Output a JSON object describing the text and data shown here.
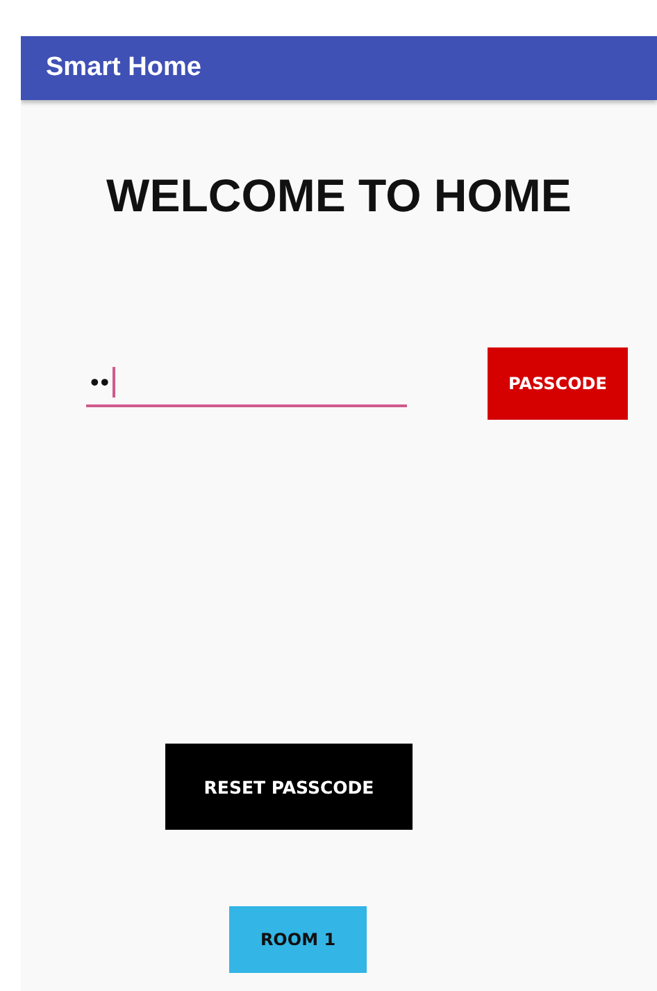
{
  "app_bar": {
    "title": "Smart Home"
  },
  "heading": "WELCOME TO HOME",
  "passcode_field": {
    "value": "••",
    "focused": true
  },
  "buttons": [
    {
      "label": "PASSCODE",
      "kind": "submit"
    },
    {
      "label": "RESET PASSCODE",
      "kind": "reset"
    },
    {
      "label": "ROOM 1",
      "kind": "room"
    }
  ]
}
